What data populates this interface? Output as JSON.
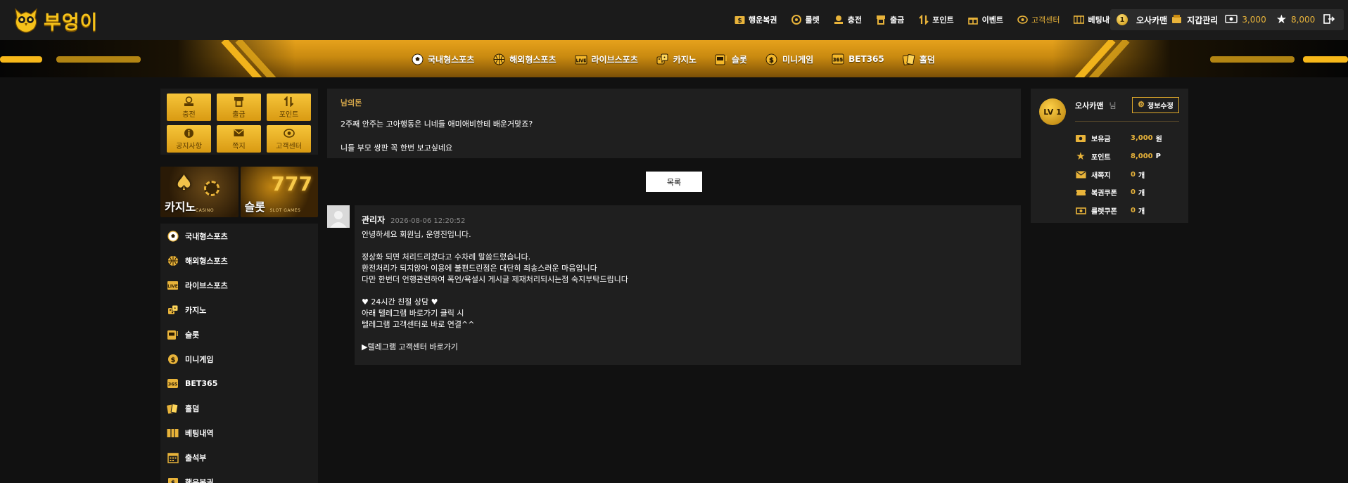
{
  "brand": {
    "name": "부엉이"
  },
  "header_nav": [
    {
      "label": "행운복권",
      "icon": "lottery-icon"
    },
    {
      "label": "룰렛",
      "icon": "roulette-icon"
    },
    {
      "label": "충전",
      "icon": "deposit-icon"
    },
    {
      "label": "출금",
      "icon": "withdraw-icon"
    },
    {
      "label": "포인트",
      "icon": "point-icon"
    },
    {
      "label": "이벤트",
      "icon": "gift-icon"
    },
    {
      "label": "고객센터",
      "icon": "support-icon"
    },
    {
      "label": "베팅내역",
      "icon": "betting-history-icon"
    }
  ],
  "user_box": {
    "level": "1",
    "username": "오사카맨",
    "wallet_label": "지갑관리",
    "balance": "3,000",
    "points": "8,000"
  },
  "game_nav": [
    {
      "label": "국내형스포츠",
      "icon": "soccer-icon"
    },
    {
      "label": "해외형스포츠",
      "icon": "basketball-icon"
    },
    {
      "label": "라이브스포츠",
      "icon": "live-icon"
    },
    {
      "label": "카지노",
      "icon": "dice-icon"
    },
    {
      "label": "슬롯",
      "icon": "slot-icon"
    },
    {
      "label": "미니게임",
      "icon": "coin-icon"
    },
    {
      "label": "BET365",
      "icon": "bet365-icon"
    },
    {
      "label": "홀덤",
      "icon": "cards-icon"
    }
  ],
  "quick_buttons": [
    {
      "label": "충전",
      "icon": "deposit-icon"
    },
    {
      "label": "출금",
      "icon": "withdraw-icon"
    },
    {
      "label": "포인트",
      "icon": "point-icon"
    },
    {
      "label": "공지사항",
      "icon": "info-icon"
    },
    {
      "label": "쪽지",
      "icon": "mail-icon"
    },
    {
      "label": "고객센터",
      "icon": "support-icon"
    }
  ],
  "banners": {
    "casino": {
      "title": "카지노",
      "sub": "CASINO"
    },
    "slot": {
      "title": "슬롯",
      "sub": "SLOT GAMES",
      "deco": "777"
    }
  },
  "side_menu": [
    {
      "label": "국내형스포츠",
      "icon": "soccer-icon"
    },
    {
      "label": "해외형스포츠",
      "icon": "basketball-icon"
    },
    {
      "label": "라이브스포츠",
      "icon": "live-icon"
    },
    {
      "label": "카지노",
      "icon": "dice-icon"
    },
    {
      "label": "슬롯",
      "icon": "slot-icon"
    },
    {
      "label": "미니게임",
      "icon": "coin-icon"
    },
    {
      "label": "BET365",
      "icon": "bet365-icon"
    },
    {
      "label": "홀덤",
      "icon": "cards-icon"
    },
    {
      "label": "베팅내역",
      "icon": "betting-history-icon"
    },
    {
      "label": "출석부",
      "icon": "calendar-icon"
    },
    {
      "label": "행운복권",
      "icon": "lottery-icon"
    }
  ],
  "post": {
    "author": "남의돈",
    "lines": [
      "2주째 안주는 고아행동은 니네들 애미애비한테 배운거맞죠?",
      "니들 부모 쌍판 꼭 한번 보고싶네요"
    ]
  },
  "list_button": "목록",
  "comment": {
    "name": "관리자",
    "date": "2026-08-06 12:20:52",
    "lines": [
      "안녕하세요 회원님, 운영진입니다.",
      "",
      "정상화 되면 처리드리겠다고 수차례 말씀드렸습니다.",
      "환전처리가 되지않아 이용에 불편드린점은 대단히 죄송스러운 마음입니다",
      "다만 한번더 언행관련하여 폭언/욕설시 게시글 제재처리되시는점 숙지부탁드립니다",
      "",
      "♥ 24시간 친절 상담 ♥",
      "아래 텔레그램 바로가기 클릭 시",
      "텔레그램 고객센터로 바로 연결^^",
      "",
      "▶텔레그램 고객센터 바로가기"
    ]
  },
  "profile_panel": {
    "level": "LV 1",
    "name": "오사카맨",
    "suffix": "님",
    "edit_label": "정보수정",
    "rows": [
      {
        "label": "보유금",
        "value": "3,000",
        "unit": "원",
        "icon": "money-icon"
      },
      {
        "label": "포인트",
        "value": "8,000",
        "unit": "P",
        "icon": "star-icon"
      },
      {
        "label": "새쪽지",
        "value": "0",
        "unit": "개",
        "icon": "mail-icon"
      },
      {
        "label": "복권쿠폰",
        "value": "0",
        "unit": "개",
        "icon": "ticket-icon"
      },
      {
        "label": "룰렛쿠폰",
        "value": "0",
        "unit": "개",
        "icon": "coupon-icon"
      }
    ]
  },
  "colors": {
    "accent_gold": "#e8b33a",
    "background": "#111111",
    "panel": "#1f1f1f"
  }
}
